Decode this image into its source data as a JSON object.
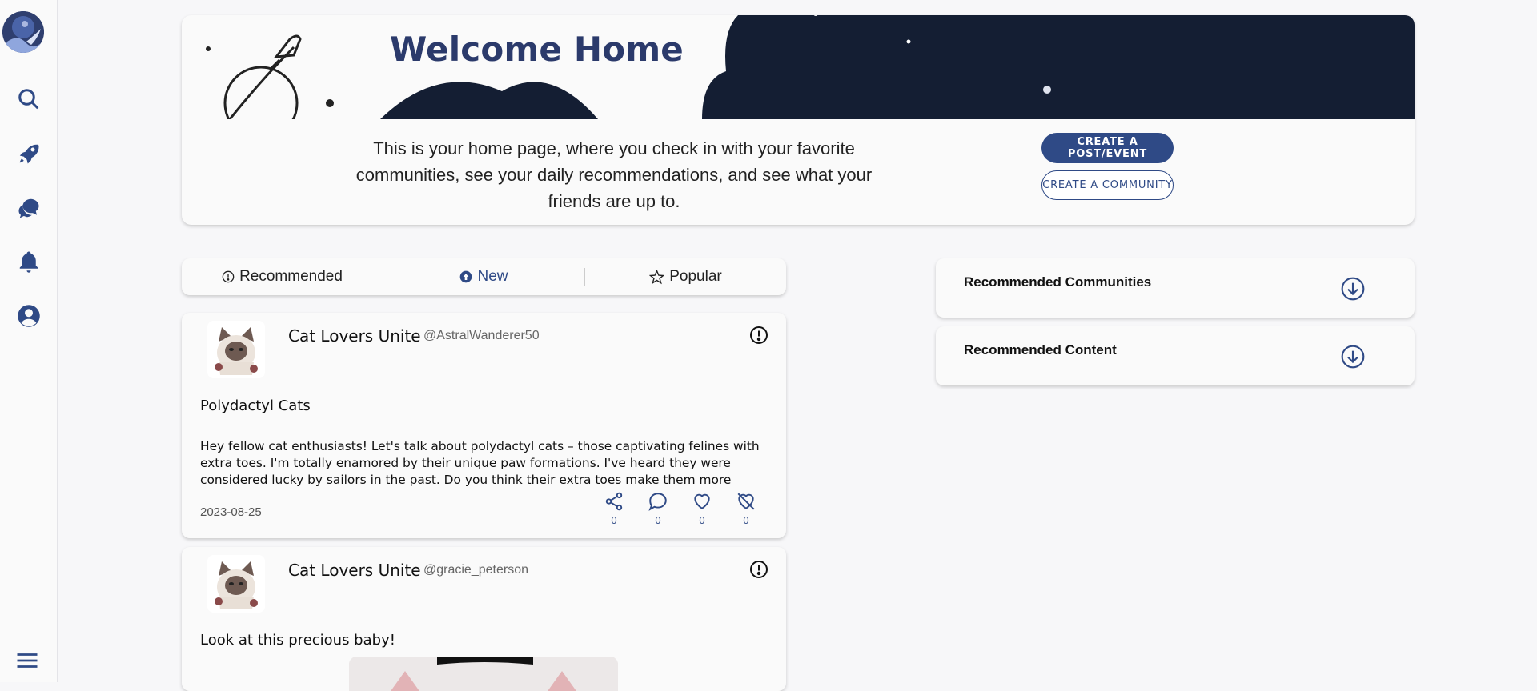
{
  "sidebar": {
    "logo": "app-logo",
    "items": [
      {
        "name": "search",
        "icon": "search-icon"
      },
      {
        "name": "explore",
        "icon": "rocket-icon"
      },
      {
        "name": "chat",
        "icon": "chat-bubbles-icon"
      },
      {
        "name": "notifications",
        "icon": "bell-icon"
      },
      {
        "name": "profile",
        "icon": "user-icon"
      }
    ],
    "menu_icon": "hamburger-menu-icon"
  },
  "banner": {
    "title": "Welcome Home",
    "description": "This is your home page, where you check in with your favorite communities, see your daily recommendations, and see what your friends are up to.",
    "create_post_label": "CREATE A POST/EVENT",
    "create_community_label": "CREATE A COMMUNITY"
  },
  "tabs": [
    {
      "label": "Recommended",
      "icon": "info-circle-icon",
      "active": false
    },
    {
      "label": "New",
      "icon": "arrow-up-circle-icon",
      "active": true
    },
    {
      "label": "Popular",
      "icon": "star-icon",
      "active": false
    }
  ],
  "posts": [
    {
      "community": "Cat Lovers Unite",
      "user": "@AstralWanderer50",
      "title": "Polydactyl Cats",
      "body": "Hey fellow cat enthusiasts! Let's talk about polydactyl cats – those captivating felines with extra toes. I'm totally enamored by their unique paw formations. I've heard they were considered lucky by sailors in the past. Do you think their extra toes make them more adept...",
      "date": "2023-08-25",
      "shares": "0",
      "comments": "0",
      "likes": "0",
      "dislikes": "0"
    },
    {
      "community": "Cat Lovers Unite",
      "user": "@gracie_peterson",
      "title": "Look at this precious baby!"
    }
  ],
  "recommended": {
    "communities_label": "Recommended Communities",
    "content_label": "Recommended Content"
  },
  "colors": {
    "brand": "#2f4a86",
    "navy": "#141e33",
    "background": "#f7f7f9"
  }
}
